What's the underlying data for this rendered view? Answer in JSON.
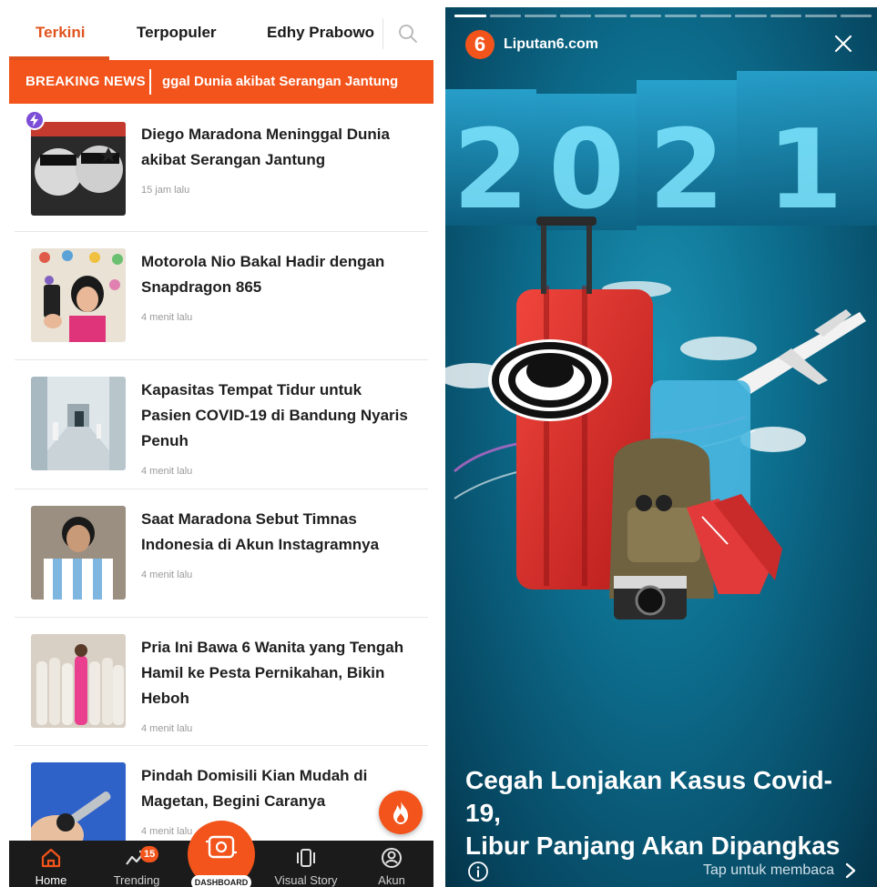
{
  "left": {
    "tabs": [
      {
        "label": "Terkini",
        "active": true
      },
      {
        "label": "Terpopuler",
        "active": false
      },
      {
        "label": "Edhy Prabowo",
        "active": false
      }
    ],
    "breaking": {
      "label": "BREAKING NEWS",
      "ticker": "ggal Dunia akibat Serangan Jantung"
    },
    "articles": [
      {
        "title_lines": [
          "Diego Maradona Meninggal Dunia",
          "akibat Serangan Jantung"
        ],
        "time": "15 jam lalu"
      },
      {
        "title_lines": [
          "Motorola Nio Bakal Hadir dengan",
          "Snapdragon 865"
        ],
        "time": "4 menit lalu"
      },
      {
        "title_lines": [
          "Kapasitas Tempat Tidur untuk",
          "Pasien COVID-19 di Bandung Nyaris",
          "Penuh"
        ],
        "time": "4 menit lalu"
      },
      {
        "title_lines": [
          "Saat Maradona Sebut Timnas",
          "Indonesia di Akun Instagramnya"
        ],
        "time": "4 menit lalu"
      },
      {
        "title_lines": [
          "Pria Ini Bawa 6 Wanita yang Tengah",
          "Hamil ke Pesta Pernikahan, Bikin",
          "Heboh"
        ],
        "time": "4 menit lalu"
      },
      {
        "title_lines": [
          "Pindah Domisili Kian Mudah di",
          "Magetan, Begini Caranya"
        ],
        "time": "4 menit lalu"
      }
    ],
    "nav": {
      "home": "Home",
      "trending": "Trending",
      "trending_badge": "15",
      "dashboard": "DASHBOARD",
      "visual_story": "Visual Story",
      "akun": "Akun"
    },
    "colors": {
      "accent": "#f2541b",
      "tab_active": "#e0531e",
      "nav_bg": "#1b1b1b"
    }
  },
  "right": {
    "brand_logo": "6",
    "brand": "Liputan6.com",
    "progress_total": 12,
    "progress_done": 1,
    "hero_digits": [
      "2",
      "0",
      "2",
      "1"
    ],
    "story_title_lines": [
      "Cegah Lonjakan Kasus Covid-19,",
      "Libur Panjang Akan Dipangkas"
    ],
    "tap_text": "Tap untuk membaca"
  }
}
